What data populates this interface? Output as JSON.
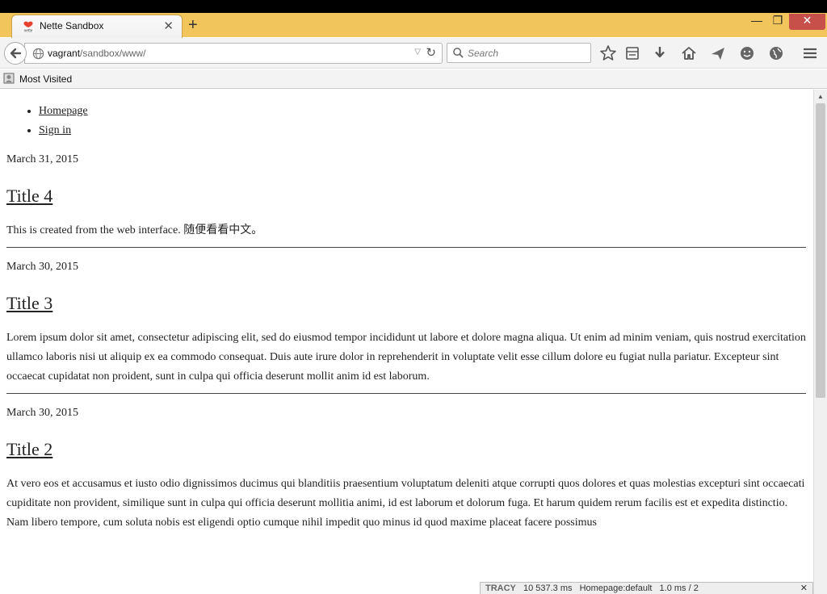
{
  "browser": {
    "tab_title": "Nette Sandbox",
    "url_host": "vagrant",
    "url_path": "/sandbox/www/",
    "search_placeholder": "Search",
    "bookmarks_label": "Most Visited",
    "new_tab_label": "+",
    "tab_close_label": "✕",
    "window": {
      "minimize": "—",
      "maximize": "❐",
      "close": "✕"
    }
  },
  "nav": [
    {
      "label": "Homepage"
    },
    {
      "label": "Sign in"
    }
  ],
  "posts": [
    {
      "date": "March 31, 2015",
      "title": "Title 4",
      "body": "This is created from the web interface. 随便看看中文。"
    },
    {
      "date": "March 30, 2015",
      "title": "Title 3",
      "body": "Lorem ipsum dolor sit amet, consectetur adipiscing elit, sed do eiusmod tempor incididunt ut labore et dolore magna aliqua. Ut enim ad minim veniam, quis nostrud exercitation ullamco laboris nisi ut aliquip ex ea commodo consequat. Duis aute irure dolor in reprehenderit in voluptate velit esse cillum dolore eu fugiat nulla pariatur. Excepteur sint occaecat cupidatat non proident, sunt in culpa qui officia deserunt mollit anim id est laborum."
    },
    {
      "date": "March 30, 2015",
      "title": "Title 2",
      "body": "At vero eos et accusamus et iusto odio dignissimos ducimus qui blanditiis praesentium voluptatum deleniti atque corrupti quos dolores et quas molestias excepturi sint occaecati cupiditate non provident, similique sunt in culpa qui officia deserunt mollitia animi, id est laborum et dolorum fuga. Et harum quidem rerum facilis est et expedita distinctio. Nam libero tempore, cum soluta nobis est eligendi optio cumque nihil impedit quo minus id quod maxime placeat facere possimus"
    }
  ],
  "tracy": {
    "logo": "TRACY",
    "time": "10 537.3 ms",
    "route": "Homepage:default",
    "db": "1.0 ms / 2",
    "close": "✕"
  },
  "colors": {
    "titlebar": "#f2c55c",
    "window_close": "#c7504a",
    "text": "#222222"
  }
}
